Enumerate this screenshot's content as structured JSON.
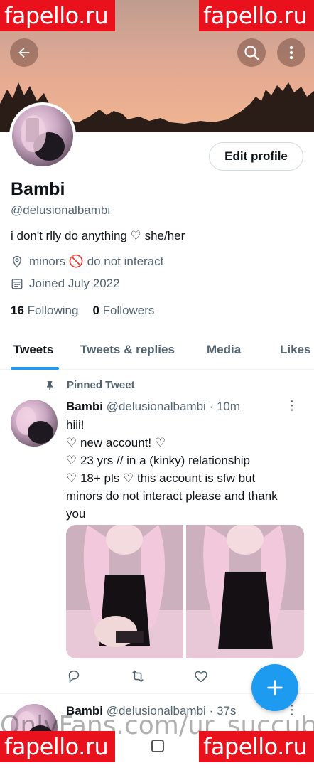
{
  "watermarks": {
    "top_left": "fapello.ru",
    "top_right": "fapello.ru",
    "bottom_left": "fapello.ru",
    "bottom_right": "fapello.ru",
    "bottom_overlay": "OnlyFans.com/ur_succub"
  },
  "header": {
    "back_icon": "arrow-left-icon",
    "search_icon": "search-icon",
    "more_icon": "more-vertical-icon"
  },
  "profile": {
    "name": "Bambi",
    "handle": "@delusionalbambi",
    "bio": "i don't rlly do anything ♡ she/her",
    "location": "minors 🚫 do not interact",
    "joined": "Joined July 2022",
    "edit_button": "Edit profile",
    "following_count": "16",
    "following_label": "Following",
    "followers_count": "0",
    "followers_label": "Followers"
  },
  "tabs": [
    {
      "label": "Tweets",
      "active": true
    },
    {
      "label": "Tweets & replies",
      "active": false
    },
    {
      "label": "Media",
      "active": false
    },
    {
      "label": "Likes",
      "active": false
    }
  ],
  "tweets": [
    {
      "pinned_label": "Pinned Tweet",
      "name": "Bambi",
      "handle": "@delusionalbambi",
      "time": "· 10m",
      "lines": [
        "hiii!",
        "♡ new account! ♡",
        "♡ 23 yrs // in a (kinky) relationship",
        "♡ 18+ pls ♡ this account is sfw but",
        "minors do not interact please and thank",
        "you"
      ]
    },
    {
      "name": "Bambi",
      "handle": "@delusionalbambi",
      "time": "· 37s"
    }
  ],
  "colors": {
    "accent": "#1d9bf0",
    "watermark_red": "#e8111c",
    "text_primary": "#0f1419",
    "text_secondary": "#536471"
  }
}
